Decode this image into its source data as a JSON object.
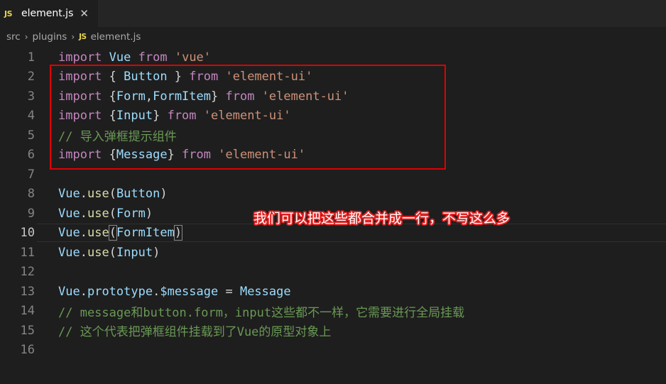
{
  "tab": {
    "badge": "JS",
    "label": "element.js",
    "close": "✕"
  },
  "breadcrumb": {
    "seg1": "src",
    "seg2": "plugins",
    "sep": "›",
    "badge": "JS",
    "file": "element.js"
  },
  "editor": {
    "active_line": 10,
    "lines": [
      {
        "num": "1",
        "tokens": [
          {
            "t": "import",
            "c": "kw"
          },
          {
            "t": " ",
            "c": "pl"
          },
          {
            "t": "Vue",
            "c": "id"
          },
          {
            "t": " ",
            "c": "pl"
          },
          {
            "t": "from",
            "c": "kw"
          },
          {
            "t": " ",
            "c": "pl"
          },
          {
            "t": "'vue'",
            "c": "str"
          }
        ]
      },
      {
        "num": "2",
        "tokens": [
          {
            "t": "import",
            "c": "kw"
          },
          {
            "t": " { ",
            "c": "pl"
          },
          {
            "t": "Button",
            "c": "id"
          },
          {
            "t": " } ",
            "c": "pl"
          },
          {
            "t": "from",
            "c": "kw"
          },
          {
            "t": " ",
            "c": "pl"
          },
          {
            "t": "'element-ui'",
            "c": "str"
          }
        ]
      },
      {
        "num": "3",
        "tokens": [
          {
            "t": "import",
            "c": "kw"
          },
          {
            "t": " {",
            "c": "pl"
          },
          {
            "t": "Form",
            "c": "id"
          },
          {
            "t": ",",
            "c": "pl"
          },
          {
            "t": "FormItem",
            "c": "id"
          },
          {
            "t": "} ",
            "c": "pl"
          },
          {
            "t": "from",
            "c": "kw"
          },
          {
            "t": " ",
            "c": "pl"
          },
          {
            "t": "'element-ui'",
            "c": "str"
          }
        ]
      },
      {
        "num": "4",
        "tokens": [
          {
            "t": "import",
            "c": "kw"
          },
          {
            "t": " {",
            "c": "pl"
          },
          {
            "t": "Input",
            "c": "id"
          },
          {
            "t": "} ",
            "c": "pl"
          },
          {
            "t": "from",
            "c": "kw"
          },
          {
            "t": " ",
            "c": "pl"
          },
          {
            "t": "'element-ui'",
            "c": "str"
          }
        ]
      },
      {
        "num": "5",
        "tokens": [
          {
            "t": "// 导入弹框提示组件",
            "c": "cmt"
          }
        ]
      },
      {
        "num": "6",
        "tokens": [
          {
            "t": "import",
            "c": "kw"
          },
          {
            "t": " {",
            "c": "pl"
          },
          {
            "t": "Message",
            "c": "id"
          },
          {
            "t": "} ",
            "c": "pl"
          },
          {
            "t": "from",
            "c": "kw"
          },
          {
            "t": " ",
            "c": "pl"
          },
          {
            "t": "'element-ui'",
            "c": "str"
          }
        ]
      },
      {
        "num": "7",
        "tokens": []
      },
      {
        "num": "8",
        "tokens": [
          {
            "t": "Vue",
            "c": "id"
          },
          {
            "t": ".",
            "c": "pl"
          },
          {
            "t": "use",
            "c": "fn"
          },
          {
            "t": "(",
            "c": "pl"
          },
          {
            "t": "Button",
            "c": "id"
          },
          {
            "t": ")",
            "c": "pl"
          }
        ]
      },
      {
        "num": "9",
        "tokens": [
          {
            "t": "Vue",
            "c": "id"
          },
          {
            "t": ".",
            "c": "pl"
          },
          {
            "t": "use",
            "c": "fn"
          },
          {
            "t": "(",
            "c": "pl"
          },
          {
            "t": "Form",
            "c": "id"
          },
          {
            "t": ")",
            "c": "pl"
          }
        ]
      },
      {
        "num": "10",
        "tokens": [
          {
            "t": "Vue",
            "c": "id"
          },
          {
            "t": ".",
            "c": "pl"
          },
          {
            "t": "use",
            "c": "fn"
          },
          {
            "t": "(",
            "c": "pl brk"
          },
          {
            "t": "FormItem",
            "c": "id"
          },
          {
            "t": ")",
            "c": "pl brk"
          }
        ]
      },
      {
        "num": "11",
        "tokens": [
          {
            "t": "Vue",
            "c": "id"
          },
          {
            "t": ".",
            "c": "pl"
          },
          {
            "t": "use",
            "c": "fn"
          },
          {
            "t": "(",
            "c": "pl"
          },
          {
            "t": "Input",
            "c": "id"
          },
          {
            "t": ")",
            "c": "pl"
          }
        ]
      },
      {
        "num": "12",
        "tokens": []
      },
      {
        "num": "13",
        "tokens": [
          {
            "t": "Vue",
            "c": "id"
          },
          {
            "t": ".",
            "c": "pl"
          },
          {
            "t": "prototype",
            "c": "id"
          },
          {
            "t": ".",
            "c": "pl"
          },
          {
            "t": "$message",
            "c": "id"
          },
          {
            "t": " = ",
            "c": "pl"
          },
          {
            "t": "Message",
            "c": "id"
          }
        ]
      },
      {
        "num": "14",
        "tokens": [
          {
            "t": "// message和button.form，input这些都不一样，它需要进行全局挂载",
            "c": "cmt"
          }
        ]
      },
      {
        "num": "15",
        "tokens": [
          {
            "t": "// 这个代表把弹框组件挂载到了Vue的原型对象上",
            "c": "cmt"
          }
        ]
      },
      {
        "num": "16",
        "tokens": []
      }
    ]
  },
  "annotation": {
    "note": "我们可以把这些都合并成一行，不写这么多",
    "box_color": "#e00000"
  }
}
